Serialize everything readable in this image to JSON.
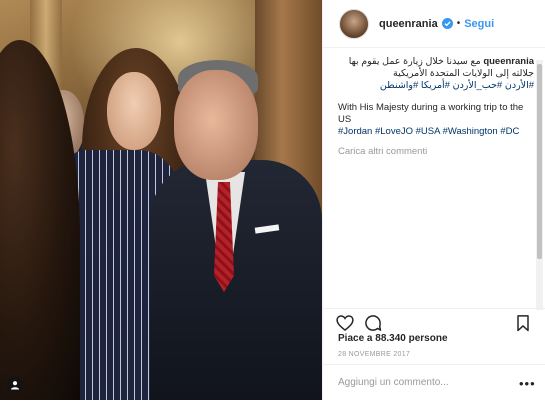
{
  "post": {
    "username": "queenrania",
    "follow_label": "Segui",
    "separator": "•"
  },
  "caption": {
    "username": "queenrania",
    "arabic_text": "مع سيدنا خلال زيارة عمل يقوم بها جلالته إلى الولايات المتحدة الأمريكية",
    "arabic_tags": "#الأردن #حب_الأردن #أمريكا #واشنطن",
    "english_text": "With His Majesty during a working trip to the US",
    "english_tags": "#Jordan #LoveJO #USA #Washington #DC",
    "load_more": "Carica altri commenti"
  },
  "actions": {
    "like_icon": "heart-icon",
    "comment_icon": "comment-icon",
    "save_icon": "bookmark-icon"
  },
  "likes_text": "Piace a 88.340 persone",
  "date_text": "28 NOVEMBRE 2017",
  "comment_box": {
    "placeholder": "Aggiungi un commento...",
    "more_label": "•••"
  },
  "colors": {
    "link": "#3897f0",
    "hashtag": "#003569",
    "muted": "#999999",
    "border": "#efefef"
  }
}
